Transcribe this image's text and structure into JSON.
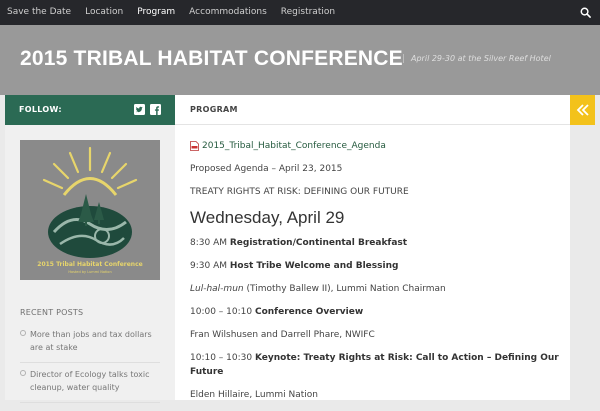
{
  "nav": {
    "items": [
      {
        "label": "Save the Date"
      },
      {
        "label": "Location"
      },
      {
        "label": "Program"
      },
      {
        "label": "Accommodations"
      },
      {
        "label": "Registration"
      }
    ],
    "active_index": 2
  },
  "header": {
    "title": "2015 TRIBAL HABITAT CONFERENCE",
    "tagline": "April 29-30 at the Silver Reef Hotel"
  },
  "sidebar": {
    "follow_label": "FOLLOW:",
    "logo_title": "2015 Tribal Habitat Conference",
    "logo_sub": "Hosted by Lummi Nation",
    "recent_title": "RECENT POSTS",
    "recent_posts": [
      {
        "title": "More than jobs and tax dollars are at stake"
      },
      {
        "title": "Director of Ecology talks toxic cleanup, water quality"
      }
    ]
  },
  "main": {
    "section_label": "PROGRAM",
    "agenda_file": "2015_Tribal_Habitat_Conference_Agenda",
    "proposed": "Proposed Agenda – April 23, 2015",
    "theme": "TREATY RIGHTS AT RISK: DEFINING OUR FUTURE",
    "day": "Wednesday, April 29",
    "items": {
      "i1_time": "8:30 AM",
      "i1_title": "Registration/Continental Breakfast",
      "i2_time": "9:30 AM",
      "i2_title": "Host Tribe Welcome and Blessing",
      "i3_name": "Lul-hal-mun",
      "i3_rest": "(Timothy Ballew II), Lummi Nation Chairman",
      "i4_time": "10:00 – 10:10",
      "i4_title": "Conference Overview",
      "i5_text": "Fran Wilshusen and Darrell Phare, NWIFC",
      "i6_time": "10:10 – 10:30",
      "i6_title": "Keynote: Treaty Rights at Risk: Call to Action – Defining Our Future",
      "i7_text": "Elden Hillaire, Lummi Nation"
    }
  },
  "colors": {
    "topbar": "#26272b",
    "header": "#999999",
    "follow_bar": "#2b6a54",
    "accent_yellow": "#f3c21b"
  },
  "icons": {
    "search": "search-icon",
    "twitter": "twitter-icon",
    "facebook": "facebook-icon",
    "collapse": "double-chevron-left-icon",
    "pdf": "pdf-icon"
  }
}
